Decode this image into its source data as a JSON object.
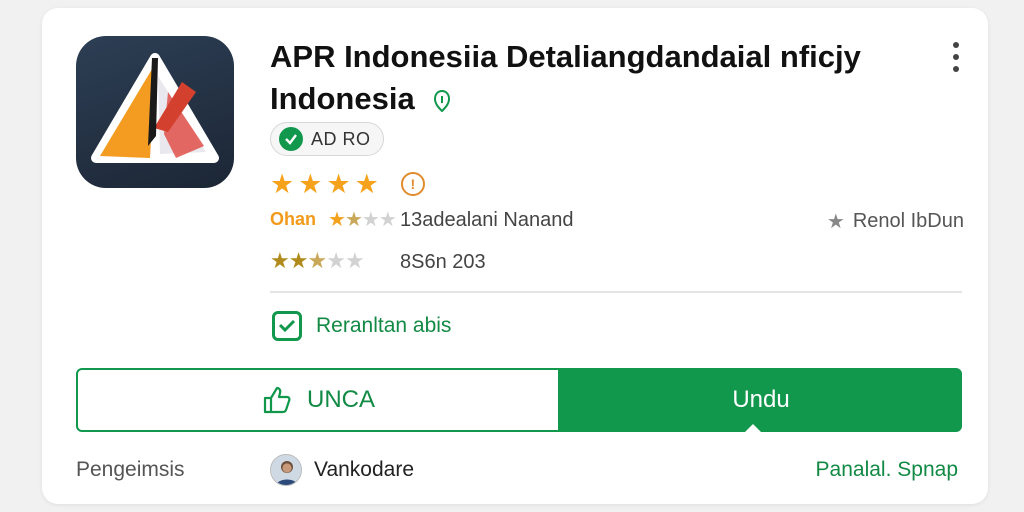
{
  "app": {
    "title_line1": "APR Indonesiia Detaliangdandaial nficjy",
    "title_line2": "Indonesia",
    "ad_badge": "AD RO",
    "rating_label": "Ohan",
    "rating_stars_main": 4,
    "rating_row1_stars": 2.5,
    "rating_row2_stars": 2.5,
    "reviews_text": "13adealani Nanand",
    "size_text": "8S6n 203",
    "right_info": "Renol IbDun",
    "feature_label": "Reranltan abis"
  },
  "buttons": {
    "secondary_label": "UNCA",
    "primary_label": "Undu"
  },
  "footer": {
    "left_label": "Pengeimsis",
    "developer_name": "Vankodare",
    "right_link": "Panalal. Spnap"
  },
  "colors": {
    "accent_green": "#11984d",
    "star_orange": "#f6a21c",
    "icon_bg": "#1c2635"
  },
  "icons": [
    "app-logo-icon",
    "verified-shield-icon",
    "more-vert-icon",
    "check-circle-icon",
    "info-icon",
    "star-icon",
    "checkbox-icon",
    "thumbs-up-icon",
    "avatar"
  ]
}
